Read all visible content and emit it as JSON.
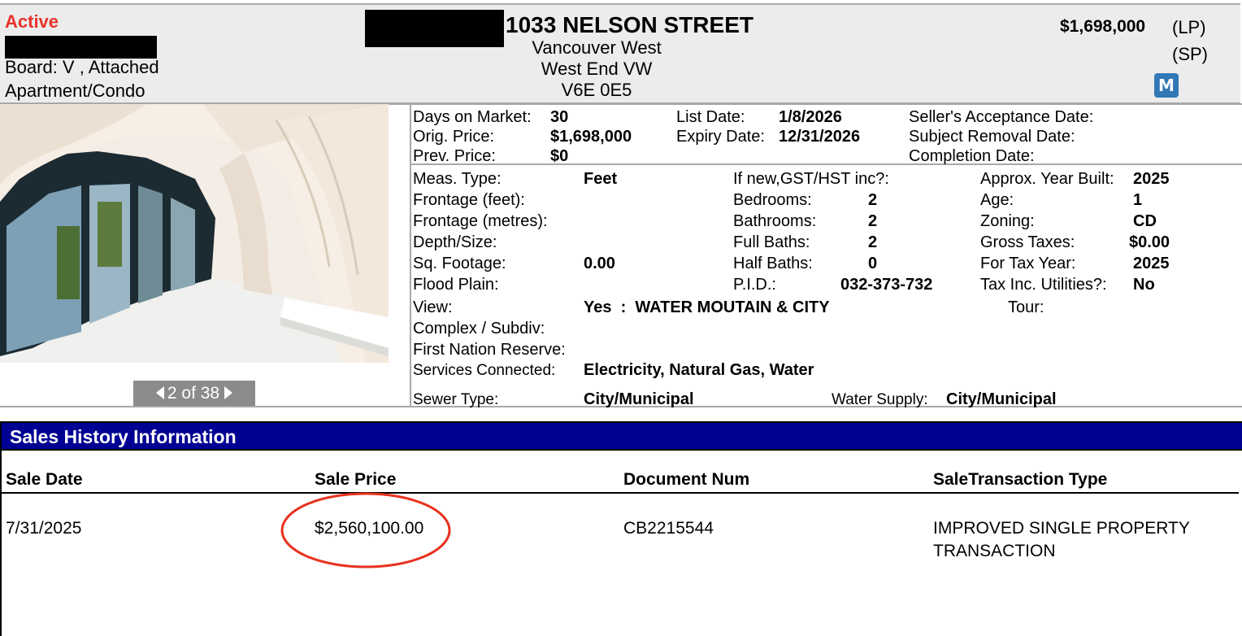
{
  "header": {
    "status": "Active",
    "board": "Board: V , Attached",
    "type": "Apartment/Condo",
    "address": "1033 NELSON STREET",
    "area": "Vancouver West",
    "subarea": "West End VW",
    "postal": "V6E 0E5",
    "list_price": "$1,698,000",
    "lp_label": "(LP)",
    "sp_label": "(SP)",
    "badge": "M"
  },
  "photo": {
    "pager": "2 of 38"
  },
  "dates": {
    "dom_label": "Days on Market:",
    "dom": "30",
    "orig_label": "Orig. Price:",
    "orig": "$1,698,000",
    "prev_label": "Prev. Price:",
    "prev": "$0",
    "list_label": "List Date:",
    "list": "1/8/2026",
    "expiry_label": "Expiry Date:",
    "expiry": "12/31/2026",
    "accept_label": "Seller's Acceptance Date:",
    "subject_label": "Subject Removal Date:",
    "completion_label": "Completion Date:"
  },
  "details": {
    "meas_label": "Meas. Type:",
    "meas": "Feet",
    "front_ft_label": "Frontage (feet):",
    "front_m_label": "Frontage (metres):",
    "depth_label": "Depth/Size:",
    "sqft_label": "Sq. Footage:",
    "sqft": "0.00",
    "flood_label": "Flood Plain:",
    "view_label": "View:",
    "view": "Yes  :  WATER MOUTAIN & CITY",
    "complex_label": "Complex / Subdiv:",
    "first_nation_label": "First Nation Reserve:",
    "services_label": "Services Connected:",
    "services": "Electricity, Natural Gas, Water",
    "sewer_label": "Sewer Type:",
    "sewer": "City/Municipal",
    "water_label": "Water Supply:",
    "water": "City/Municipal",
    "gst_label": "If new,GST/HST inc?:",
    "bed_label": "Bedrooms:",
    "bed": "2",
    "bath_label": "Bathrooms:",
    "bath": "2",
    "full_label": "Full Baths:",
    "full": "2",
    "half_label": "Half Baths:",
    "half": "0",
    "pid_label": "P.I.D.:",
    "pid": "032-373-732",
    "tour_label": "Tour:",
    "year_label": "Approx. Year Built:",
    "year": "2025",
    "age_label": "Age:",
    "age": "1",
    "zoning_label": "Zoning:",
    "zoning": "CD",
    "taxes_label": "Gross Taxes:",
    "taxes": "$0.00",
    "taxyear_label": "For Tax Year:",
    "taxyear": "2025",
    "utilities_label": "Tax Inc. Utilities?:",
    "utilities": "No"
  },
  "sales_history": {
    "title": "Sales History Information",
    "columns": [
      "Sale Date",
      "Sale Price",
      "Document Num",
      "SaleTransaction Type"
    ],
    "rows": [
      {
        "date": "7/31/2025",
        "price": "$2,560,100.00",
        "doc": "CB2215544",
        "type_line1": "IMPROVED SINGLE PROPERTY",
        "type_line2": "TRANSACTION"
      }
    ]
  }
}
